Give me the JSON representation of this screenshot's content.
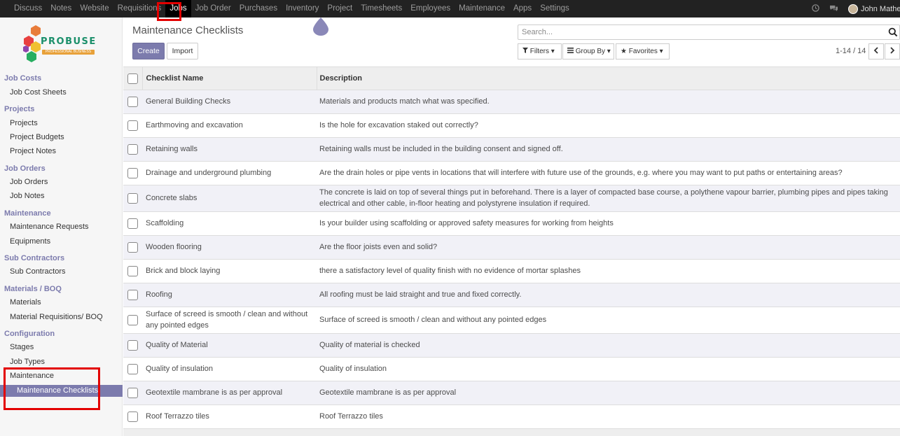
{
  "topnav": {
    "items": [
      {
        "label": "Discuss"
      },
      {
        "label": "Notes"
      },
      {
        "label": "Website"
      },
      {
        "label": "Requisitions"
      },
      {
        "label": "Jobs"
      },
      {
        "label": "Job Order"
      },
      {
        "label": "Purchases"
      },
      {
        "label": "Inventory"
      },
      {
        "label": "Project"
      },
      {
        "label": "Timesheets"
      },
      {
        "label": "Employees"
      },
      {
        "label": "Maintenance"
      },
      {
        "label": "Apps"
      },
      {
        "label": "Settings"
      }
    ],
    "active": "Jobs",
    "user_name": "John Mathew"
  },
  "logo": {
    "name": "PROBUSE",
    "tagline": "PROFESSIONAL BUSINESS"
  },
  "sidebar": {
    "sections": [
      {
        "title": "Job Costs",
        "items": [
          "Job Cost Sheets"
        ]
      },
      {
        "title": "Projects",
        "items": [
          "Projects",
          "Project Budgets",
          "Project Notes"
        ]
      },
      {
        "title": "Job Orders",
        "items": [
          "Job Orders",
          "Job Notes"
        ]
      },
      {
        "title": "Maintenance",
        "items": [
          "Maintenance Requests",
          "Equipments"
        ]
      },
      {
        "title": "Sub Contractors",
        "items": [
          "Sub Contractors"
        ]
      },
      {
        "title": "Materials / BOQ",
        "items": [
          "Materials",
          "Material Requisitions/ BOQ"
        ]
      },
      {
        "title": "Configuration",
        "items": [
          "Stages",
          "Job Types",
          "Maintenance"
        ]
      }
    ],
    "active_item": "Maintenance Checklists"
  },
  "control": {
    "title": "Maintenance Checklists",
    "create_label": "Create",
    "import_label": "Import",
    "search_placeholder": "Search...",
    "filters_label": "Filters",
    "groupby_label": "Group By",
    "favorites_label": "Favorites",
    "pager": "1-14 / 14"
  },
  "table": {
    "headers": {
      "name": "Checklist Name",
      "description": "Description"
    },
    "rows": [
      {
        "name": "General Building Checks",
        "description": "Materials and products match what was specified."
      },
      {
        "name": "Earthmoving and excavation",
        "description": "Is the hole for excavation staked out correctly?"
      },
      {
        "name": "Retaining walls",
        "description": "Retaining walls must be included in the building consent and signed off."
      },
      {
        "name": "Drainage and underground plumbing",
        "description": "Are the drain holes or pipe vents in locations that will interfere with future use of the grounds, e.g. where you may want to put paths or entertaining areas?"
      },
      {
        "name": "Concrete slabs",
        "description": "The concrete is laid on top of several things put in beforehand. There is a layer of compacted base course, a polythene vapour barrier, plumbing pipes and pipes taking electrical and other cable, in-floor heating and polystyrene insulation if required."
      },
      {
        "name": "Scaffolding",
        "description": "Is your builder using scaffolding or approved safety measures for working from heights"
      },
      {
        "name": "Wooden flooring",
        "description": "Are the floor joists even and solid?"
      },
      {
        "name": "Brick and block laying",
        "description": "there a satisfactory level of quality finish with no evidence of mortar splashes"
      },
      {
        "name": "Roofing",
        "description": "All roofing must be laid straight and true and fixed correctly."
      },
      {
        "name": "Surface of screed is smooth / clean and without any pointed edges",
        "description": "Surface of screed is smooth / clean and without any pointed edges"
      },
      {
        "name": "Quality of Material",
        "description": "Quality of material is checked"
      },
      {
        "name": "Quality of insulation",
        "description": "Quality of insulation"
      },
      {
        "name": "Geotextile mambrane is as per approval",
        "description": "Geotextile mambrane is as per approval"
      },
      {
        "name": "Roof Terrazzo tiles",
        "description": "Roof Terrazzo tiles"
      }
    ]
  },
  "colors": {
    "topbar": "#222222",
    "accent": "#7c7bad",
    "highlight": "#e30000"
  }
}
